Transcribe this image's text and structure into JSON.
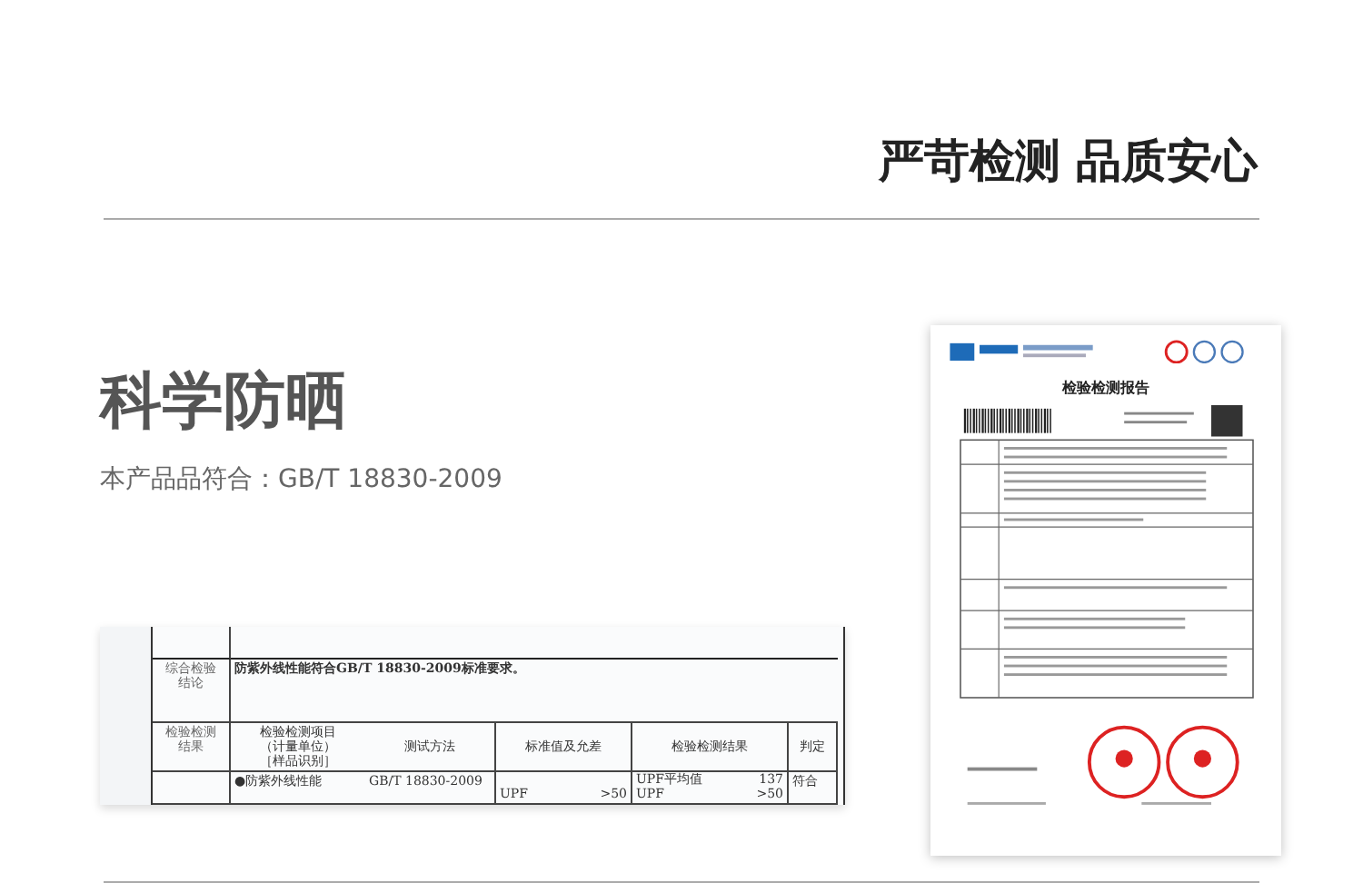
{
  "header": {
    "slogan": "严苛检测 品质安心"
  },
  "section": {
    "title": "科学防晒",
    "standard_note": "本产品品符合：GB/T 18830-2009"
  },
  "report_excerpt": {
    "conclusion_label": [
      "综合检验",
      "结论"
    ],
    "conclusion": "防紫外线性能符合GB/T 18830-2009标准要求。",
    "results_label": [
      "检验检测",
      "结果"
    ],
    "columns": [
      [
        "检验检测项目",
        "（计量单位）",
        "［样品识别］"
      ],
      [
        "测试方法"
      ],
      [
        "标准值及允差"
      ],
      [
        "检验检测结果"
      ],
      [
        "判定"
      ]
    ],
    "row": {
      "item": "●防紫外线性能",
      "method": "GB/T 18830-2009",
      "standard_name": "UPF",
      "standard_value": ">50",
      "result_lines": [
        {
          "name": "UPF平均值",
          "value": "137"
        },
        {
          "name": "UPF",
          "value": ">50"
        }
      ],
      "verdict": "符合"
    }
  },
  "report": {
    "title": "检验检测报告"
  }
}
